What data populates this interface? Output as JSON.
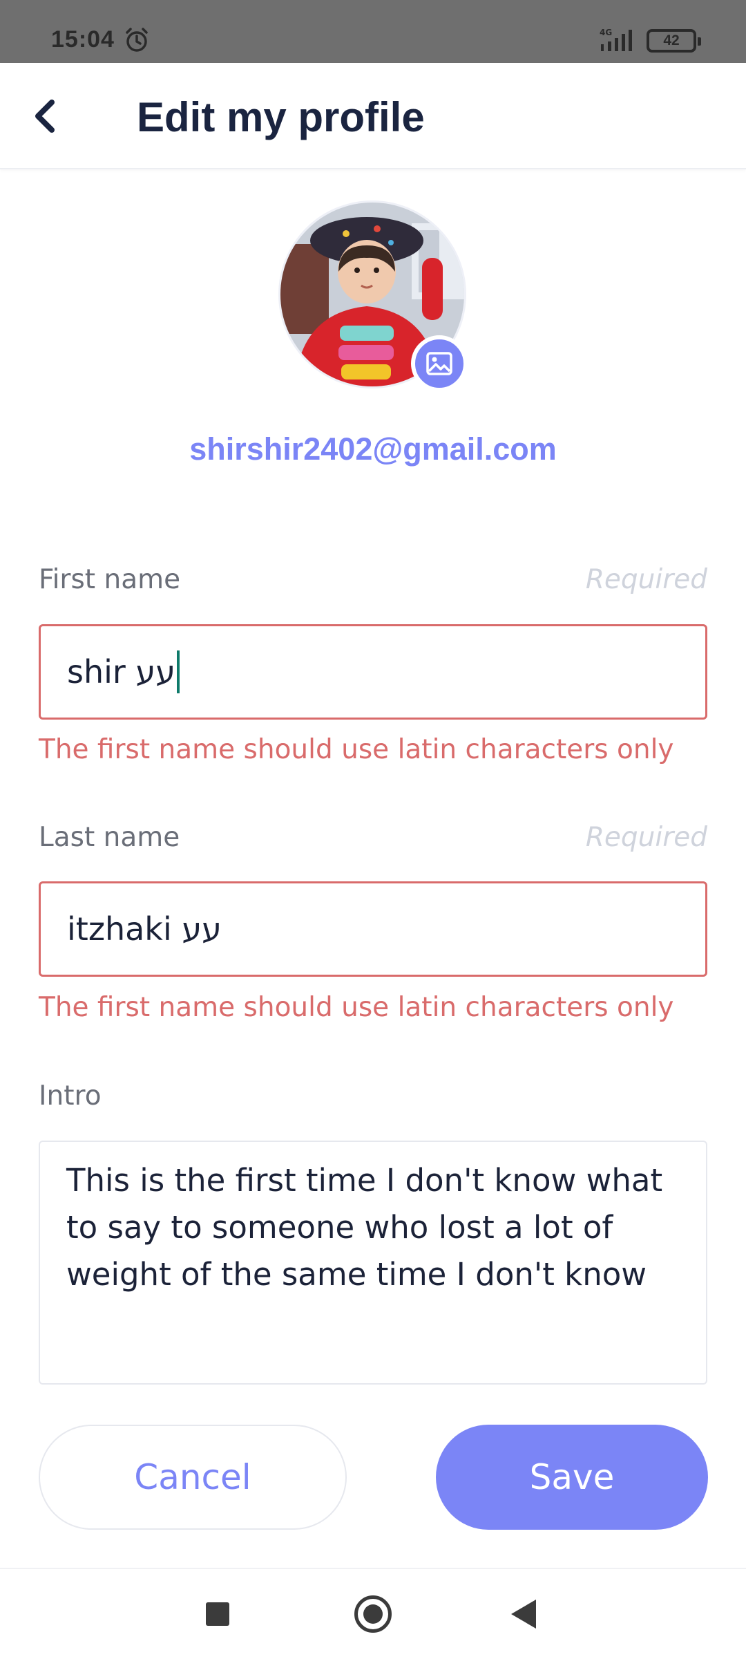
{
  "status_bar": {
    "time": "15:04",
    "network": "4G",
    "battery": "42"
  },
  "header": {
    "title": "Edit my profile"
  },
  "profile": {
    "email": "shirshir2402@gmail.com"
  },
  "form": {
    "first_name": {
      "label": "First name",
      "hint": "Required",
      "value": "shir עע",
      "error": "The first name should use latin characters only"
    },
    "last_name": {
      "label": "Last name",
      "hint": "Required",
      "value": "itzhaki עע",
      "error": "The first name should use latin characters only"
    },
    "intro": {
      "label": "Intro",
      "value": "This is the first time I don't know what to say to someone who lost a lot of weight of the same time I don't know"
    }
  },
  "buttons": {
    "cancel": "Cancel",
    "save": "Save"
  },
  "colors": {
    "accent": "#7b85f6",
    "error": "#d96b6b",
    "title": "#1a2440"
  },
  "icons": {
    "back": "chevron-left-icon",
    "alarm": "alarm-clock-icon",
    "signal": "cell-signal-icon",
    "battery": "battery-icon",
    "change_photo": "image-icon",
    "nav_recents": "square-icon",
    "nav_home": "circle-icon",
    "nav_back": "triangle-back-icon"
  }
}
